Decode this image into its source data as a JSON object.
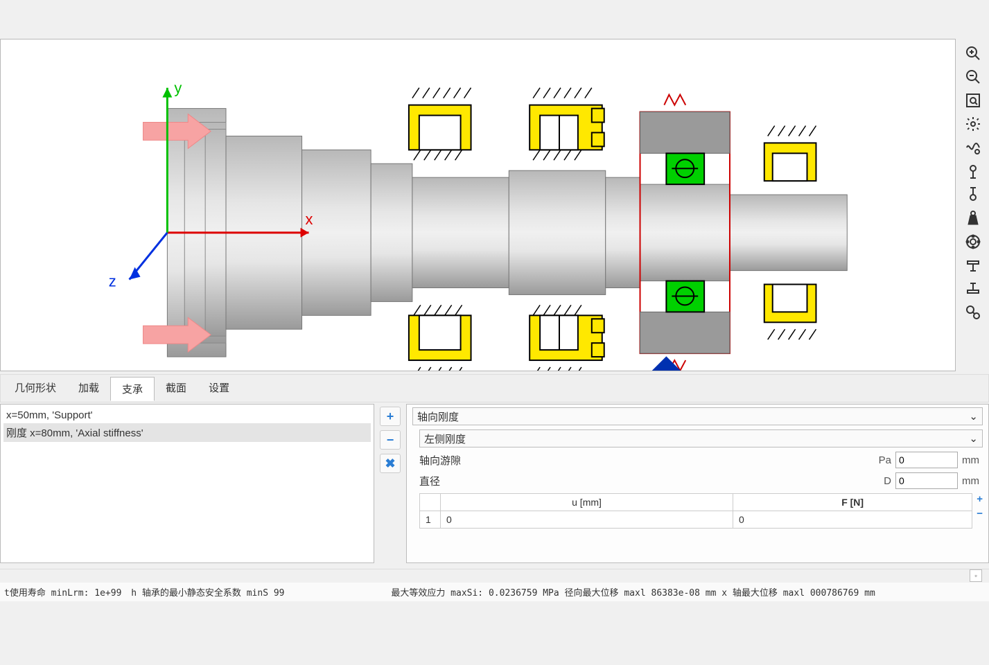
{
  "axis_labels": {
    "x": "x",
    "y": "y",
    "z": "z"
  },
  "toolbar": [
    "zoom-in",
    "zoom-out",
    "fit",
    "settings",
    "wave",
    "scale-top",
    "scale-bottom",
    "weight",
    "bearing",
    "support-top",
    "support-bottom",
    "run"
  ],
  "tabs": [
    {
      "id": "geometry",
      "label": "几何形状",
      "active": false
    },
    {
      "id": "load",
      "label": "加载",
      "active": false
    },
    {
      "id": "support",
      "label": "支承",
      "active": true
    },
    {
      "id": "section",
      "label": "截面",
      "active": false
    },
    {
      "id": "settings",
      "label": "设置",
      "active": false
    }
  ],
  "list_items": [
    {
      "text": "x=50mm, 'Support'",
      "selected": false
    },
    {
      "text": "刚度  x=80mm, 'Axial stiffness'",
      "selected": true
    }
  ],
  "list_buttons": {
    "add": "+",
    "remove": "−",
    "delete": "✖"
  },
  "props": {
    "title_combo": "轴向刚度",
    "side_combo": "左侧刚度",
    "clearance": {
      "label": "轴向游隙",
      "symbol": "Pa",
      "value": "0",
      "unit": "mm"
    },
    "diameter": {
      "label": "直径",
      "symbol": "D",
      "value": "0",
      "unit": "mm"
    },
    "table": {
      "headers": [
        "",
        "u [mm]",
        "F [N]"
      ],
      "rows": [
        {
          "idx": "1",
          "u": "0",
          "f": "0"
        }
      ]
    }
  },
  "status": {
    "s1": "t使用寿命 minLrm: 1e+99",
    "s2": "h  轴承的最小静态安全系数 minS 99",
    "s3": "最大等效应力 maxSi: 0.0236759  MPa 径向最大位移 maxl  86383e-08  mm  x 轴最大位移 maxl  000786769  mm"
  }
}
